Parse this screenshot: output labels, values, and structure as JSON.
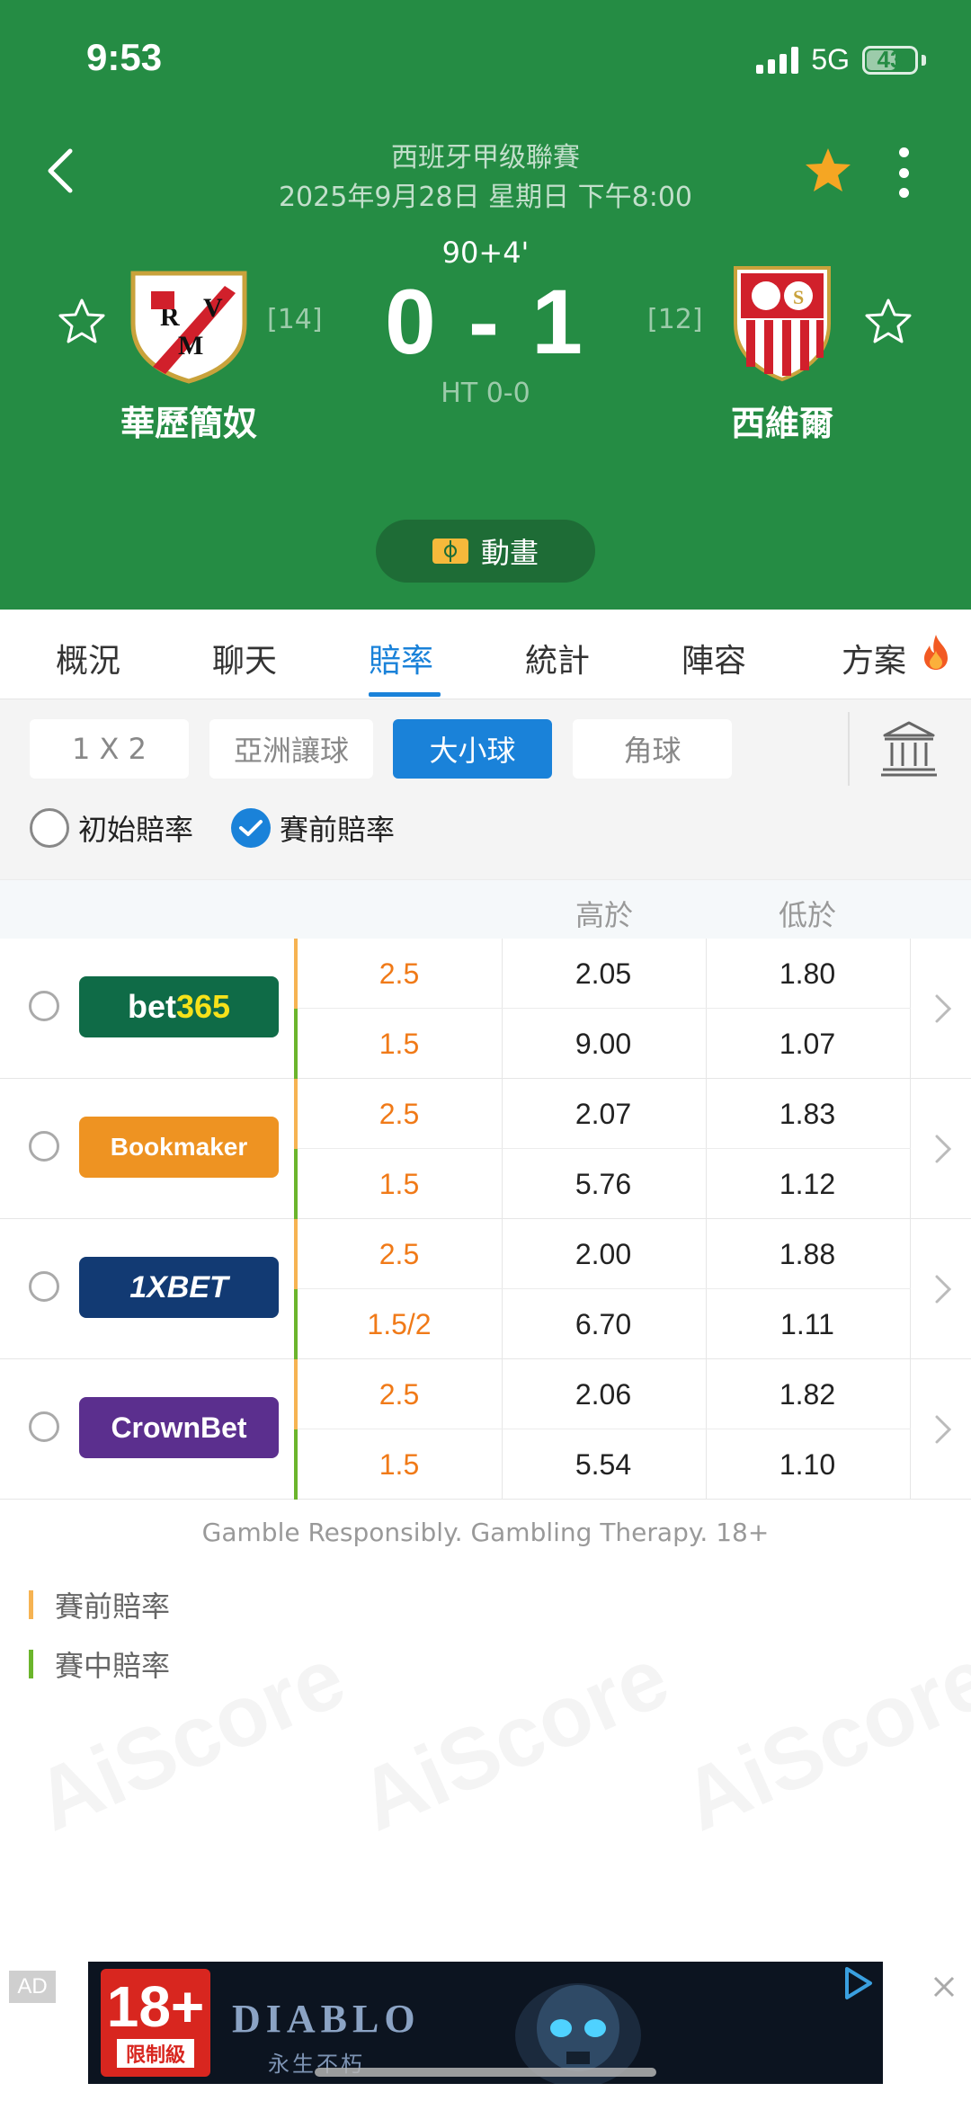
{
  "status": {
    "time": "9:53",
    "network": "5G",
    "battery": "43"
  },
  "match": {
    "league": "西班牙甲级聯賽",
    "datetime": "2025年9月28日 星期日 下午8:00",
    "minute": "90+4'",
    "score": "0 - 1",
    "halftime": "HT 0-0",
    "home": {
      "name": "華歷簡奴",
      "rank": "[14]",
      "logo_letters": "RVM"
    },
    "away": {
      "name": "西維爾",
      "rank": "[12]"
    },
    "animation_label": "動畫"
  },
  "tabs": [
    "概況",
    "聊天",
    "賠率",
    "統計",
    "陣容",
    "方案"
  ],
  "active_tab": "賠率",
  "chips": [
    "1 X 2",
    "亞洲讓球",
    "大小球",
    "角球"
  ],
  "active_chip": "大小球",
  "options": {
    "initial": "初始賠率",
    "prematch": "賽前賠率"
  },
  "table": {
    "headers": {
      "over": "高於",
      "under": "低於"
    },
    "rows": [
      {
        "bookmaker": "bet365",
        "pre": {
          "line": "2.5",
          "over": "2.05",
          "under": "1.80"
        },
        "live": {
          "line": "1.5",
          "over": "9.00",
          "under": "1.07"
        }
      },
      {
        "bookmaker": "Bookmaker",
        "pre": {
          "line": "2.5",
          "over": "2.07",
          "under": "1.83"
        },
        "live": {
          "line": "1.5",
          "over": "5.76",
          "under": "1.12"
        }
      },
      {
        "bookmaker": "1XBET",
        "pre": {
          "line": "2.5",
          "over": "2.00",
          "under": "1.88"
        },
        "live": {
          "line": "1.5/2",
          "over": "6.70",
          "under": "1.11"
        }
      },
      {
        "bookmaker": "CrownBet",
        "pre": {
          "line": "2.5",
          "over": "2.06",
          "under": "1.82"
        },
        "live": {
          "line": "1.5",
          "over": "5.54",
          "under": "1.10"
        }
      }
    ]
  },
  "footer_note": "Gamble Responsibly. Gambling Therapy. 18+",
  "legend": {
    "pre": "賽前賠率",
    "live": "賽中賠率"
  },
  "watermark": "AiScore",
  "ad": {
    "tag": "AD",
    "age": "18+",
    "rating": "限制級",
    "title": "DIABLO",
    "subtitle": "永生不朽"
  },
  "colors": {
    "header_green": "#258c44",
    "accent_blue": "#1a82d9",
    "line_orange": "#f07a18",
    "pre_bar": "#f6b352",
    "live_bar": "#6bb52c",
    "star": "#f5a623"
  }
}
